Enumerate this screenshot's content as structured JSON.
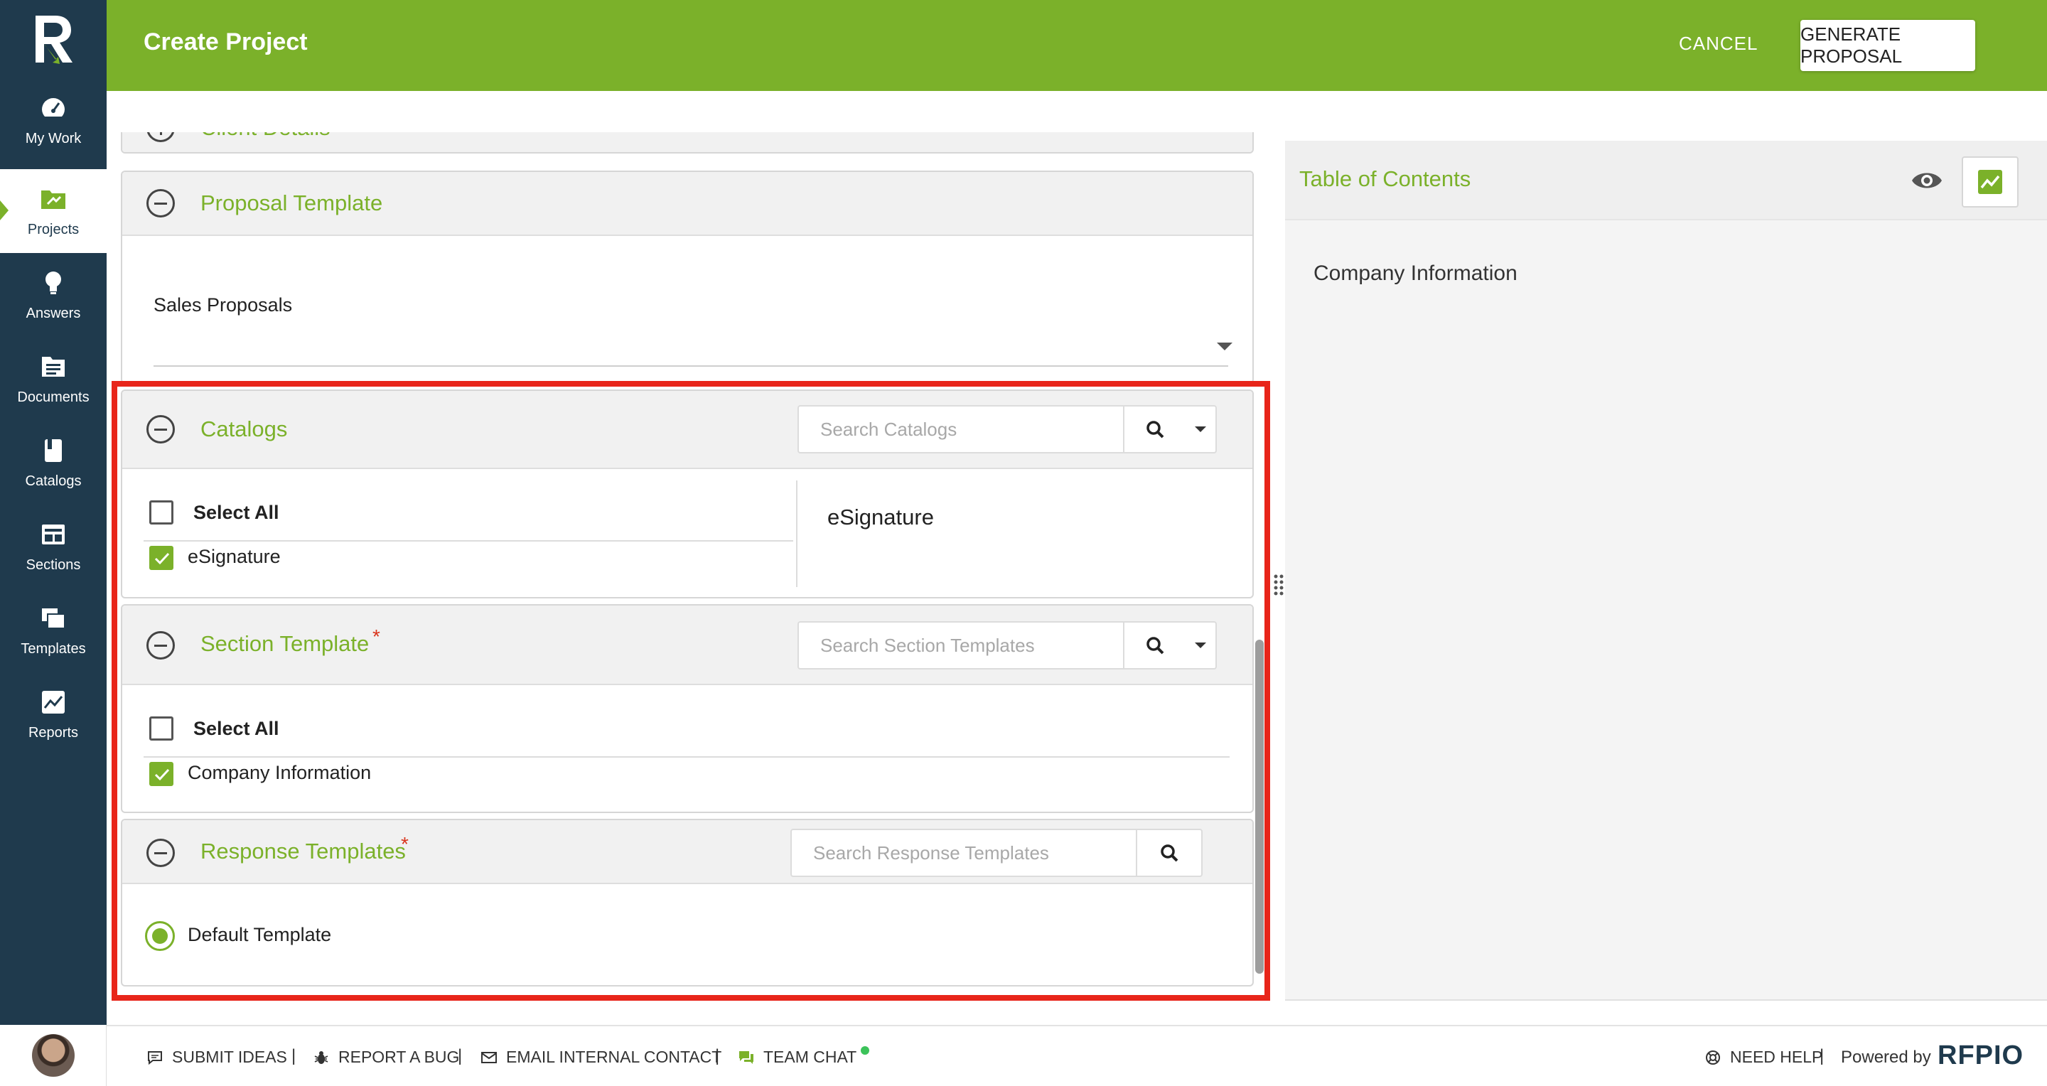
{
  "colors": {
    "brand_green": "#7bb12a",
    "sidebar_navy": "#1f3a4d",
    "required_star": "#d9341c",
    "highlight_red": "#e8251a"
  },
  "sidebar": {
    "logo_icon": "rfpio-r-logo",
    "items": [
      {
        "label": "My Work",
        "icon": "speedometer-icon",
        "active": false
      },
      {
        "label": "Projects",
        "icon": "folder-icon",
        "active": true
      },
      {
        "label": "Answers",
        "icon": "lightbulb-icon",
        "active": false
      },
      {
        "label": "Documents",
        "icon": "documents-icon",
        "active": false
      },
      {
        "label": "Catalogs",
        "icon": "book-icon",
        "active": false
      },
      {
        "label": "Sections",
        "icon": "sections-icon",
        "active": false
      },
      {
        "label": "Templates",
        "icon": "templates-icon",
        "active": false
      },
      {
        "label": "Reports",
        "icon": "chart-icon",
        "active": false
      }
    ]
  },
  "header": {
    "title": "Create Project",
    "cancel_label": "CANCEL",
    "generate_label": "GENERATE PROPOSAL"
  },
  "client_details": {
    "title": "Client Details"
  },
  "proposal_template": {
    "title": "Proposal Template",
    "selected": "Sales Proposals"
  },
  "catalogs": {
    "title": "Catalogs",
    "search_placeholder": "Search Catalogs",
    "select_all_label": "Select All",
    "items": [
      {
        "label": "eSignature",
        "checked": true
      }
    ],
    "preview_title": "eSignature"
  },
  "section_template": {
    "title": "Section Template",
    "required_mark": "*",
    "search_placeholder": "Search Section Templates",
    "select_all_label": "Select All",
    "items": [
      {
        "label": "Company Information",
        "checked": true
      }
    ]
  },
  "response_templates": {
    "title": "Response Templates",
    "required_mark": "*",
    "search_placeholder": "Search Response Templates",
    "items": [
      {
        "label": "Default Template",
        "selected": true
      }
    ]
  },
  "toc": {
    "title": "Table of Contents",
    "items": [
      "Company Information"
    ]
  },
  "footer": {
    "submit_ideas": "SUBMIT IDEAS",
    "report_bug": "REPORT A BUG",
    "email_contact": "EMAIL INTERNAL CONTACT",
    "team_chat": "TEAM CHAT",
    "need_help": "NEED HELP",
    "powered_by": "Powered by",
    "brand": "RFPIO",
    "separator": "|"
  }
}
